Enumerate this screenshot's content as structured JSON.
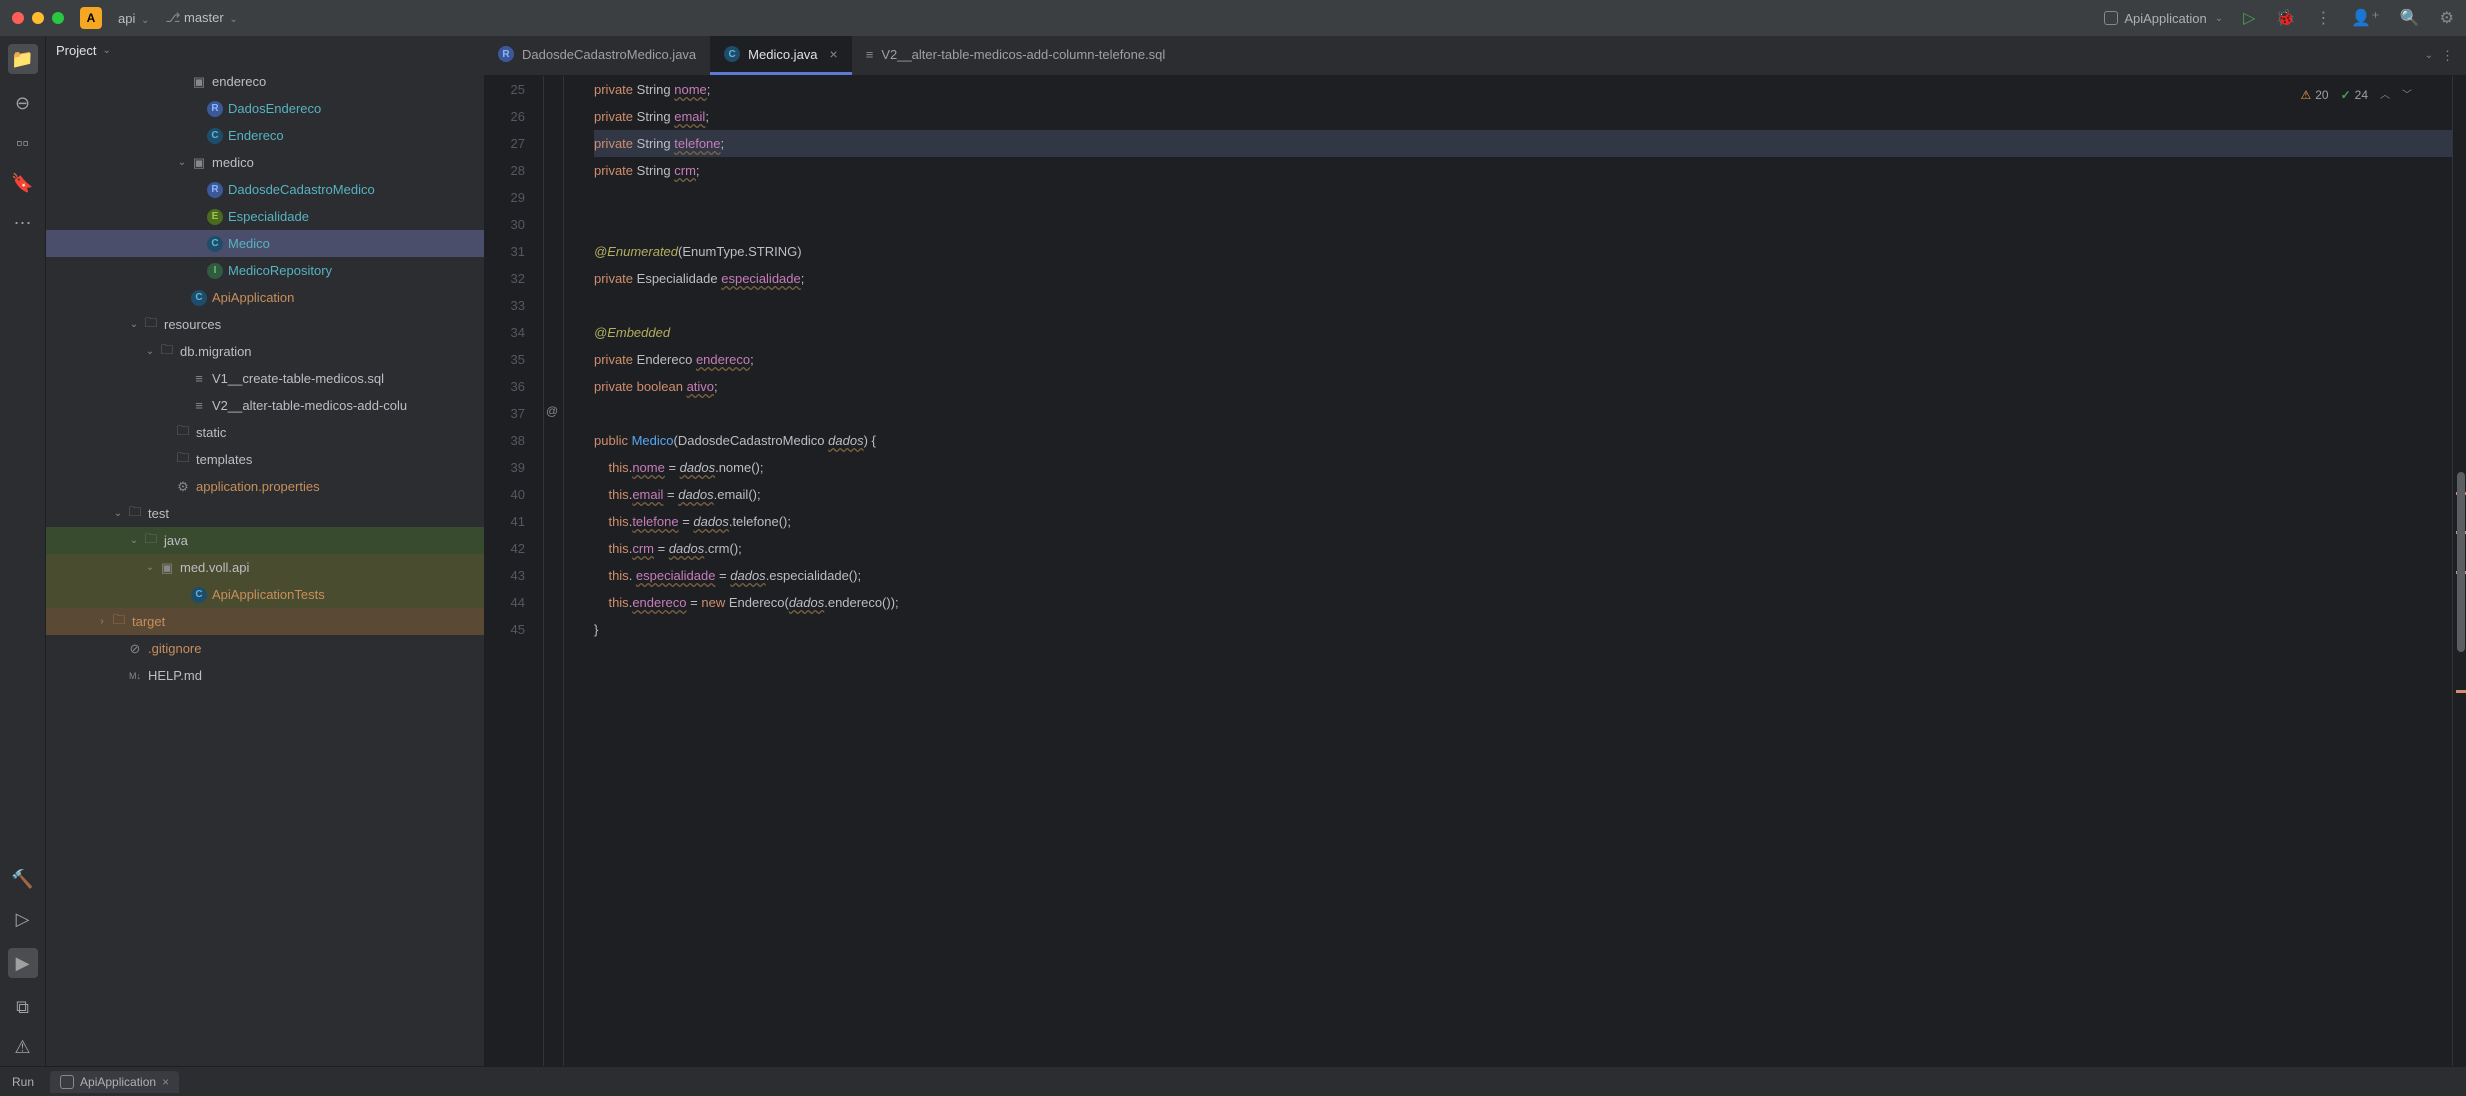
{
  "titlebar": {
    "app_letter": "A",
    "app_name": "api",
    "branch": "master",
    "run_config": "ApiApplication"
  },
  "panel": {
    "header": "Project"
  },
  "tree": [
    {
      "indent": 8,
      "arrow": "",
      "icon": "package",
      "label": "endereco",
      "cls": ""
    },
    {
      "indent": 9,
      "arrow": "",
      "icon": "R",
      "label": "DadosEndereco",
      "cls": "teal"
    },
    {
      "indent": 9,
      "arrow": "",
      "icon": "C",
      "label": "Endereco",
      "cls": "teal"
    },
    {
      "indent": 8,
      "arrow": "down",
      "icon": "package",
      "label": "medico",
      "cls": ""
    },
    {
      "indent": 9,
      "arrow": "",
      "icon": "R",
      "label": "DadosdeCadastroMedico",
      "cls": "teal"
    },
    {
      "indent": 9,
      "arrow": "",
      "icon": "E",
      "label": "Especialidade",
      "cls": "teal"
    },
    {
      "indent": 9,
      "arrow": "",
      "icon": "C",
      "label": "Medico",
      "cls": "teal",
      "selected": true
    },
    {
      "indent": 9,
      "arrow": "",
      "icon": "I",
      "label": "MedicoRepository",
      "cls": "teal"
    },
    {
      "indent": 8,
      "arrow": "",
      "icon": "C",
      "label": "ApiApplication",
      "cls": "orange"
    },
    {
      "indent": 5,
      "arrow": "down",
      "icon": "folder",
      "label": "resources",
      "cls": ""
    },
    {
      "indent": 6,
      "arrow": "down",
      "icon": "folder",
      "label": "db.migration",
      "cls": ""
    },
    {
      "indent": 8,
      "arrow": "",
      "icon": "sql",
      "label": "V1__create-table-medicos.sql",
      "cls": ""
    },
    {
      "indent": 8,
      "arrow": "",
      "icon": "sql",
      "label": "V2__alter-table-medicos-add-colu",
      "cls": ""
    },
    {
      "indent": 7,
      "arrow": "",
      "icon": "folder",
      "label": "static",
      "cls": ""
    },
    {
      "indent": 7,
      "arrow": "",
      "icon": "folder",
      "label": "templates",
      "cls": ""
    },
    {
      "indent": 7,
      "arrow": "",
      "icon": "gear",
      "label": "application.properties",
      "cls": "orange"
    },
    {
      "indent": 4,
      "arrow": "down",
      "icon": "folder",
      "label": "test",
      "cls": ""
    },
    {
      "indent": 5,
      "arrow": "down",
      "icon": "folder",
      "label": "java",
      "cls": "",
      "hl": "highlight1"
    },
    {
      "indent": 6,
      "arrow": "down",
      "icon": "package",
      "label": "med.voll.api",
      "cls": "",
      "hl": "highlight2"
    },
    {
      "indent": 8,
      "arrow": "",
      "icon": "C",
      "label": "ApiApplicationTests",
      "cls": "orange",
      "hl": "highlight2"
    },
    {
      "indent": 3,
      "arrow": "right",
      "icon": "folder-orange",
      "label": "target",
      "cls": "orange",
      "hl": "highlight3"
    },
    {
      "indent": 4,
      "arrow": "",
      "icon": "ignore",
      "label": ".gitignore",
      "cls": "orange"
    },
    {
      "indent": 4,
      "arrow": "",
      "icon": "md",
      "label": "HELP.md",
      "cls": ""
    }
  ],
  "tabs": [
    {
      "icon": "R",
      "label": "DadosdeCadastroMedico.java",
      "active": false
    },
    {
      "icon": "C",
      "label": "Medico.java",
      "active": true,
      "closable": true
    },
    {
      "icon": "sql",
      "label": "V2__alter-table-medicos-add-column-telefone.sql",
      "active": false
    }
  ],
  "editor": {
    "first_line": 25,
    "warnings": "20",
    "ok_count": "24"
  },
  "code_lines": [
    {
      "n": 25,
      "html": "<span class=\"kw\">private</span> <span class=\"type\">String</span> <span class=\"field\">nome</span>;"
    },
    {
      "n": 26,
      "html": "<span class=\"kw\">private</span> <span class=\"type\">String</span> <span class=\"field\">email</span>;"
    },
    {
      "n": 27,
      "html": "<span class=\"kw\">private</span> <span class=\"type\">String</span> <span class=\"field\">telefone</span>;",
      "sel": true
    },
    {
      "n": 28,
      "html": "<span class=\"kw\">private</span> <span class=\"type\">String</span> <span class=\"field\">crm</span>;"
    },
    {
      "n": 29,
      "html": ""
    },
    {
      "n": 30,
      "html": ""
    },
    {
      "n": 31,
      "html": "<span class=\"ann\">@Enumerated</span>(EnumType.STRING)"
    },
    {
      "n": 32,
      "html": "<span class=\"kw\">private</span> <span class=\"type\">Especialidade</span> <span class=\"field\">especialidade</span>;"
    },
    {
      "n": 33,
      "html": ""
    },
    {
      "n": 34,
      "html": "<span class=\"ann\">@Embedded</span>"
    },
    {
      "n": 35,
      "html": "<span class=\"kw\">private</span> <span class=\"type\">Endereco</span> <span class=\"field\">endereco</span>;"
    },
    {
      "n": 36,
      "html": "<span class=\"kw\">private</span> <span class=\"kw\">boolean</span> <span class=\"field\">ativo</span>;"
    },
    {
      "n": 37,
      "html": ""
    },
    {
      "n": 38,
      "html": "<span class=\"pub\">public</span> <span class=\"method\">Medico</span>(DadosdeCadastroMedico <span class=\"param\">dados</span>) {"
    },
    {
      "n": 39,
      "html": "    <span class=\"ctor-this\">this</span>.<span class=\"field\">nome</span> = <span class=\"param\">dados</span>.nome();"
    },
    {
      "n": 40,
      "html": "    <span class=\"ctor-this\">this</span>.<span class=\"field\">email</span> = <span class=\"param\">dados</span>.email();"
    },
    {
      "n": 41,
      "html": "    <span class=\"ctor-this\">this</span>.<span class=\"field\">telefone</span> = <span class=\"param\">dados</span>.telefone();"
    },
    {
      "n": 42,
      "html": "    <span class=\"ctor-this\">this</span>.<span class=\"field\">crm</span> = <span class=\"param\">dados</span>.crm();"
    },
    {
      "n": 43,
      "html": "    <span class=\"ctor-this\">this</span>. <span class=\"field\">especialidade</span> = <span class=\"param\">dados</span>.especialidade();"
    },
    {
      "n": 44,
      "html": "    <span class=\"ctor-this\">this</span>.<span class=\"field\">endereco</span> = <span class=\"kw\">new</span> Endereco(<span class=\"param\">dados</span>.endereco());"
    },
    {
      "n": 45,
      "html": "}"
    }
  ],
  "bottom": {
    "run": "Run",
    "tab": "ApiApplication"
  }
}
